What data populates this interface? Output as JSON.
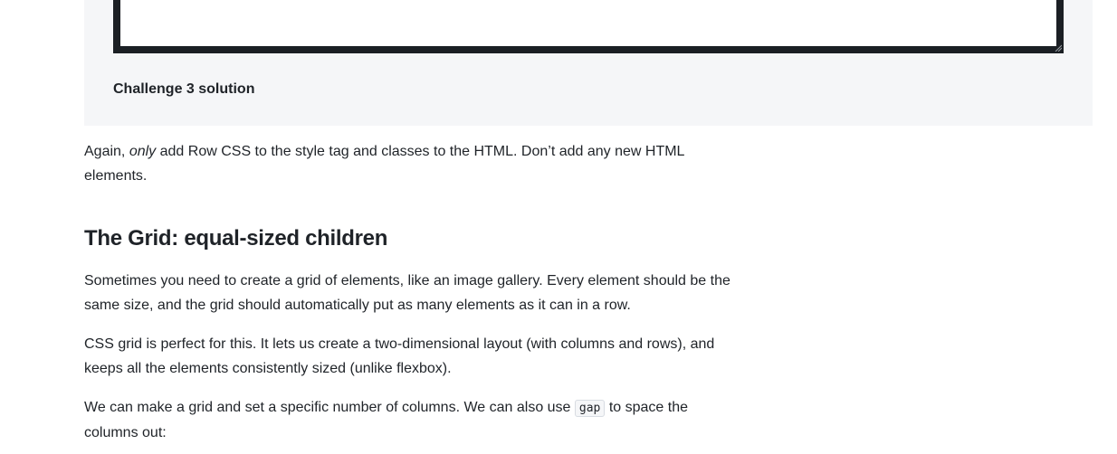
{
  "challenge": {
    "solution_label": "Challenge 3 solution"
  },
  "intro": {
    "before": "Again, ",
    "emphasis": "only",
    "after": " add Row CSS to the style tag and classes to the HTML. Don’t add any new HTML elements."
  },
  "section": {
    "heading": "The Grid: equal-sized children",
    "paragraph1": "Sometimes you need to create a grid of elements, like an image gallery. Every element should be the same size, and the grid should automatically put as many elements as it can in a row.",
    "paragraph2": "CSS grid is perfect for this. It lets us create a two-dimensional layout (with columns and rows), and keeps all the elements consistently sized (unlike flexbox).",
    "paragraph3_before": "We can make a grid and set a specific number of columns. We can also use ",
    "paragraph3_code": "gap",
    "paragraph3_after": " to space the columns out:"
  }
}
